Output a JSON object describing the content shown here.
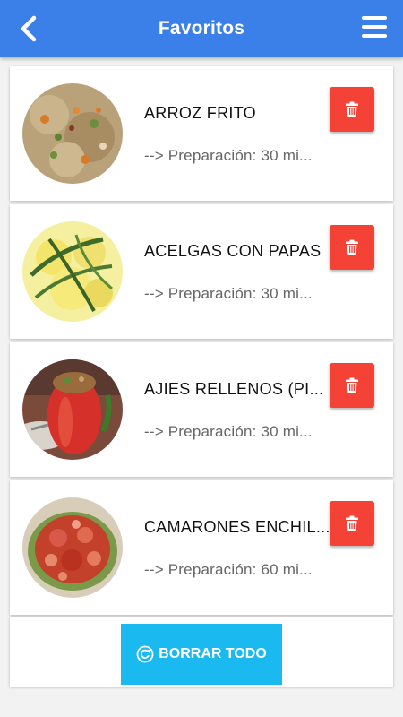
{
  "header": {
    "title": "Favoritos",
    "back_icon": "chevron-left-icon",
    "menu_icon": "hamburger-menu-icon",
    "color": "#3b7fe8"
  },
  "favorites": [
    {
      "name": "ARROZ FRITO",
      "prep": "--> Preparación: 30 mi...",
      "image": "fried-rice"
    },
    {
      "name": "ACELGAS CON PAPAS",
      "prep": "--> Preparación: 30 mi...",
      "image": "chard-with-potatoes"
    },
    {
      "name": "AJIES RELLENOS (PI...",
      "prep": "--> Preparación: 30 mi...",
      "image": "stuffed-peppers"
    },
    {
      "name": "CAMARONES ENCHIL...",
      "prep": "--> Preparación: 60 mi...",
      "image": "spicy-shrimp"
    }
  ],
  "delete_icon": "trash-icon",
  "delete_color": "#f44336",
  "footer": {
    "clear_all_label": "BORRAR TODO",
    "clear_icon": "refresh-circle-icon",
    "color": "#1ab9ef"
  }
}
